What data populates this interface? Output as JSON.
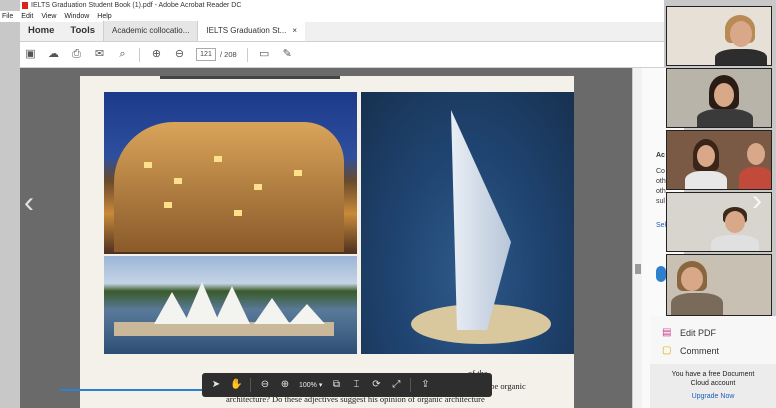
{
  "window": {
    "title": "IELTS Graduation Student Book (1).pdf - Adobe Acrobat Reader DC"
  },
  "menu": [
    "File",
    "Edit",
    "View",
    "Window",
    "Help"
  ],
  "tabs": {
    "home": "Home",
    "tools": "Tools",
    "doc1": "Academic collocatio...",
    "doc2": "IELTS Graduation St...",
    "close": "×"
  },
  "toolbar": {
    "page_current": "121",
    "page_total": "/ 208"
  },
  "zoom": {
    "value": "100%",
    "caret": "▾"
  },
  "captions": {
    "line1": "of the",
    "line2": "scribe organic",
    "line3": "architecture? Do these adjectives suggest his opinion of organic architecture"
  },
  "side": {
    "frag_a": "Ac",
    "frag_b": "Co",
    "frag_c": "oth",
    "frag_d": "oth",
    "frag_e": "sul",
    "frag_f": "Sel"
  },
  "promo": {
    "edit_pdf": "Edit PDF",
    "comment": "Comment",
    "free_line1": "You have a free Document",
    "free_line2": "Cloud account",
    "upgrade": "Upgrade Now"
  },
  "icons": {
    "save": "💾",
    "upload": "⇪",
    "print": "⎙",
    "mail": "✉",
    "search": "🔍",
    "up": "⊕",
    "down": "⊖",
    "comment": "💬",
    "pen": "✎",
    "pointer": "➤",
    "hand": "✋",
    "zoom_out": "⊖",
    "zoom_in": "⊕",
    "copy": "⧉",
    "fit": "⌶",
    "rotate": "⟳",
    "expand": "⤢",
    "share": "⇧",
    "edit": "▤",
    "chat": "▢"
  },
  "colors": {
    "accent": "#2f7fcf",
    "adobe_red": "#d9261c",
    "edit_pink": "#c83c8c"
  }
}
